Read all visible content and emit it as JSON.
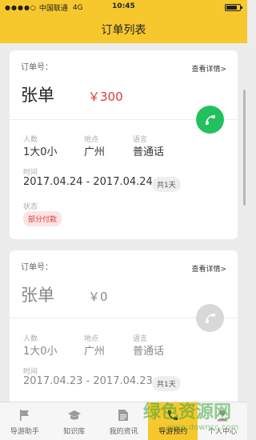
{
  "status_bar": {
    "carrier": "中国联通",
    "network": "4G",
    "time": "10:45",
    "battery_level": 0.8
  },
  "header": {
    "title": "订单列表"
  },
  "orders": [
    {
      "order_label": "订单号：",
      "detail_link": "查看详情>",
      "customer_name": "张单",
      "price": "￥300",
      "people_label": "人数",
      "people_value": "1大0小",
      "place_label": "地点",
      "place_value": "广州",
      "language_label": "语言",
      "language_value": "普通话",
      "time_label": "时间",
      "time_value": "2017.04.24 - 2017.04.24",
      "days": "共1天",
      "status_label": "状态",
      "status_value": "部分付款",
      "call_active": true
    },
    {
      "order_label": "订单号：",
      "detail_link": "查看详情>",
      "customer_name": "张单",
      "price": "￥0",
      "people_label": "人数",
      "people_value": "1大0小",
      "place_label": "地点",
      "place_value": "广州",
      "language_label": "语言",
      "language_value": "普通话",
      "time_label": "时间",
      "time_value": "2017.04.23 - 2017.04.23",
      "days": "共1天",
      "call_active": false
    }
  ],
  "tabs": [
    {
      "label": "导游助手",
      "icon": "flag-icon",
      "active": false
    },
    {
      "label": "知识库",
      "icon": "graduation-cap-icon",
      "active": false
    },
    {
      "label": "我的资讯",
      "icon": "document-icon",
      "active": false
    },
    {
      "label": "导游预约",
      "icon": "phone-icon",
      "active": true
    },
    {
      "label": "个人中心",
      "icon": "person-icon",
      "active": false
    }
  ],
  "watermark": {
    "title": "绿色资源网",
    "url": "www.downcc.com"
  },
  "colors": {
    "brand_yellow": "#f7c82e",
    "price_red": "#e03a3a",
    "call_green": "#22c15e",
    "call_disabled": "#d8d8d8"
  }
}
